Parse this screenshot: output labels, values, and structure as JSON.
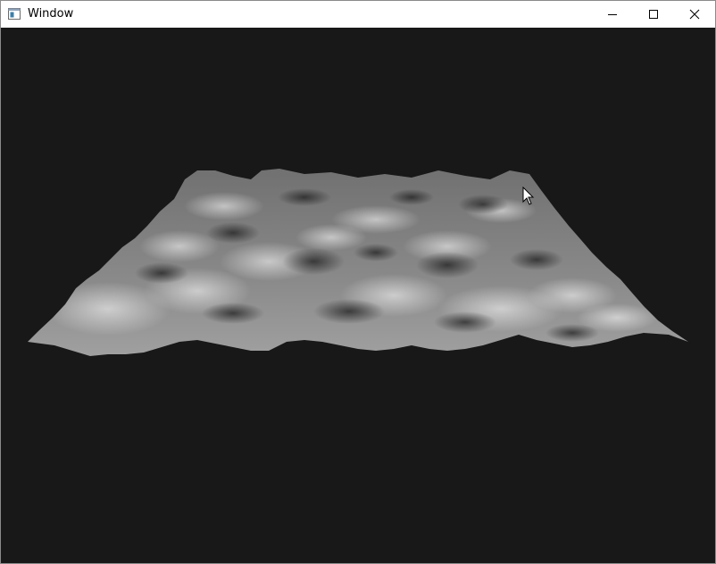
{
  "window": {
    "title": "Window",
    "controls": [
      "minimize-icon",
      "maximize-icon",
      "close-icon"
    ]
  },
  "viewport": {
    "background_color": "#181818",
    "content": "terrain-surface",
    "cursor": "pointer-arrow-icon"
  }
}
